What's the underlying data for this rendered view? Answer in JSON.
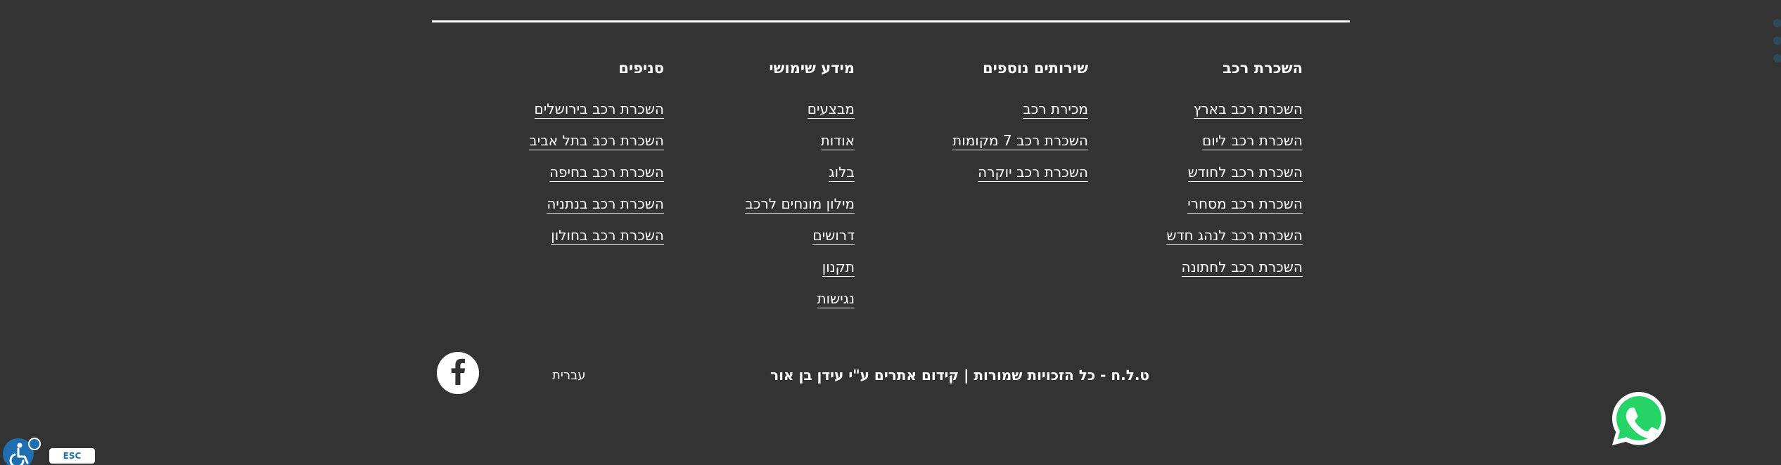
{
  "footer": {
    "columns": [
      {
        "heading": "השכרת רכב",
        "links": [
          "השכרת רכב בארץ",
          "השכרת רכב ליום",
          "השכרת רכב לחודש",
          "השכרת רכב מסחרי",
          "השכרת רכב לנהג חדש",
          "השכרת רכב לחתונה"
        ]
      },
      {
        "heading": "שירותים נוספים",
        "links": [
          "מכירת רכב",
          "השכרת רכב 7 מקומות",
          "השכרת רכב יוקרה"
        ]
      },
      {
        "heading": "מידע שימושי",
        "links": [
          "מבצעים",
          "אודות",
          "בלוג",
          "מילון מונחים לרכב",
          "דרושים",
          "תקנון",
          "נגישות"
        ]
      },
      {
        "heading": "סניפים",
        "links": [
          "השכרת רכב בירושלים",
          "השכרת רכב בתל אביב",
          "השכרת רכב בחיפה",
          "השכרת רכב בנתניה",
          "השכרת רכב בחולון"
        ]
      }
    ],
    "copyright": "ט.ל.ח - כל הזכויות שמורות | קידום אתרים ע\"י עידן בן אור",
    "language": "עברית"
  },
  "widgets": {
    "esc_label": "ESC",
    "facebook_icon": "facebook-icon",
    "whatsapp_icon": "whatsapp-icon",
    "accessibility_icon": "accessibility-icon"
  },
  "colors": {
    "background": "#333333",
    "text": "#ffffff",
    "whatsapp": "#25d366",
    "accessibility": "#1f6fb0"
  }
}
